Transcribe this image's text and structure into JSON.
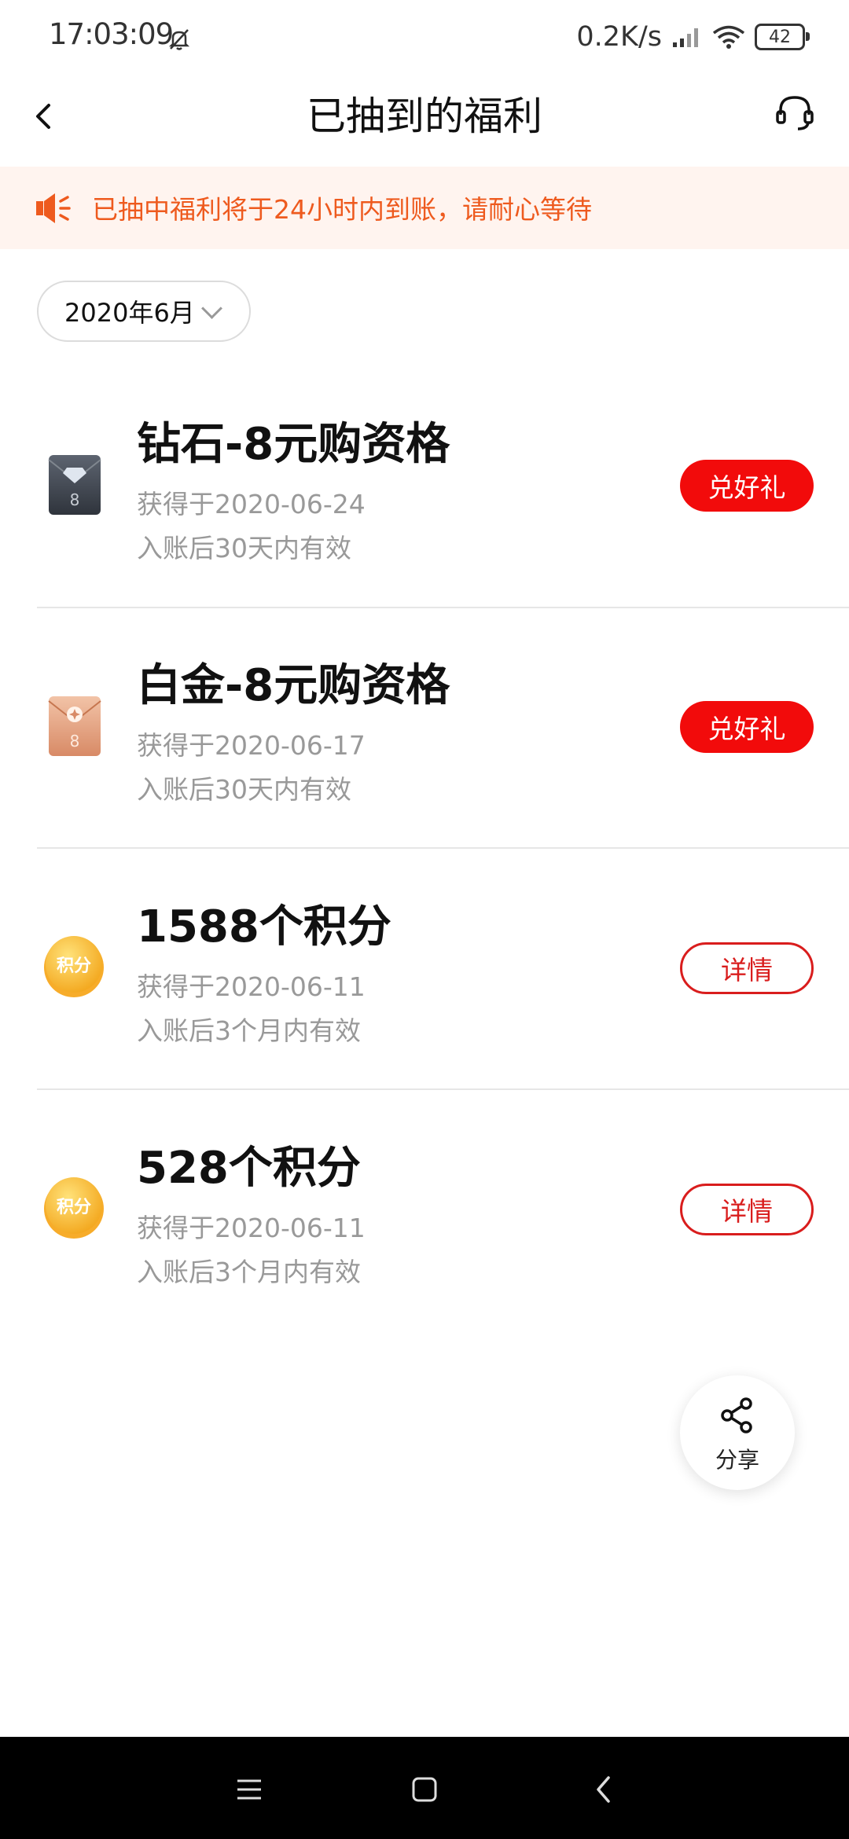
{
  "status_bar": {
    "time": "17:03:09",
    "network_speed": "0.2K/s",
    "battery": "42",
    "icons": [
      "mute-bell-icon",
      "signal-icon",
      "wifi-icon",
      "battery-icon"
    ]
  },
  "header": {
    "title": "已抽到的福利",
    "back_icon": "chevron-left-icon",
    "support_icon": "headset-icon"
  },
  "notice": {
    "icon": "speaker-icon",
    "text": "已抽中福利将于24小时内到账，请耐心等待",
    "color": "#ee5a1e",
    "background": "#fff4ef"
  },
  "filter": {
    "month_label": "2020年6月"
  },
  "rewards": [
    {
      "name": "钻石-8元购资格",
      "date": "获得于2020-06-24",
      "validity": "入账后30天内有效",
      "button": "兑好礼",
      "icon": "diamond-envelope-icon",
      "icon_text": "8"
    },
    {
      "name": "白金-8元购资格",
      "date": "获得于2020-06-17",
      "validity": "入账后30天内有效",
      "button": "兑好礼",
      "icon": "platinum-envelope-icon",
      "icon_text": "8"
    },
    {
      "name": "1588个积分",
      "date": "获得于2020-06-11",
      "validity": "入账后3个月内有效",
      "button": "详情",
      "icon": "points-coin-icon",
      "icon_text": "积分"
    },
    {
      "name": "528个积分",
      "date": "获得于2020-06-11",
      "validity": "入账后3个月内有效",
      "button": "详情",
      "icon": "points-coin-icon",
      "icon_text": "积分"
    }
  ],
  "share": {
    "label": "分享",
    "icon": "share-icon"
  },
  "colors": {
    "accent_red": "#f20b0b",
    "outline_red": "#d91d1d",
    "secondary_text": "#999999"
  }
}
